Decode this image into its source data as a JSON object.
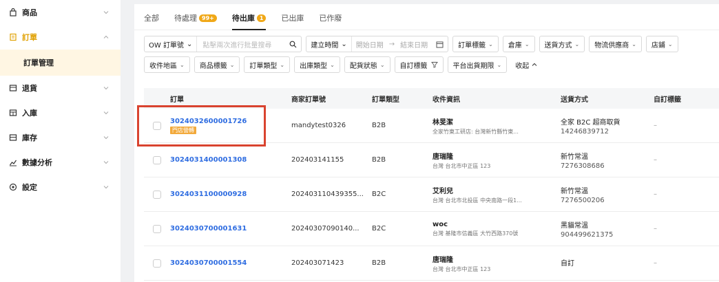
{
  "sidebar": {
    "items": [
      {
        "label": "商品",
        "icon": "bag-icon"
      },
      {
        "label": "訂單",
        "icon": "order-icon",
        "open": true
      },
      {
        "label": "退貨",
        "icon": "return-icon"
      },
      {
        "label": "入庫",
        "icon": "inbound-icon"
      },
      {
        "label": "庫存",
        "icon": "inventory-icon"
      },
      {
        "label": "數據分析",
        "icon": "chart-icon"
      },
      {
        "label": "設定",
        "icon": "settings-icon"
      }
    ],
    "sub": {
      "label": "訂單管理"
    }
  },
  "tabs": [
    {
      "label": "全部"
    },
    {
      "label": "待處理",
      "badge": "99+"
    },
    {
      "label": "待出庫",
      "badge": "1",
      "active": true
    },
    {
      "label": "已出庫"
    },
    {
      "label": "已作廢"
    }
  ],
  "filters": {
    "search_type": "OW 訂單號",
    "search_placeholder": "點擊兩次進行批量搜尋",
    "date_type": "建立時間",
    "start_date": "開始日期",
    "arrow": "→",
    "end_date": "結束日期",
    "order_tag": "訂單標籤",
    "warehouse": "倉庫",
    "shipping_method": "送貨方式",
    "logistics_provider": "物流供應商",
    "store": "店鋪",
    "recipient_region": "收件地區",
    "product_tag": "商品標籤",
    "order_type": "訂單類型",
    "outbound_type": "出庫類型",
    "allocation_status": "配貨狀態",
    "custom_tag": "自訂標籤",
    "platform_deadline": "平台出貨期限",
    "collapse": "收起"
  },
  "table": {
    "headers": [
      "訂單",
      "商家訂單號",
      "訂單類型",
      "收件資訊",
      "送貨方式",
      "自訂標籤"
    ],
    "rows": [
      {
        "order_id": "3024032600001726",
        "tag": "門店營轉",
        "merchant_no": "mandytest0326",
        "type": "B2B",
        "name": "林旻潔",
        "address": "全家竹東工研店: 台灣新竹縣竹東...",
        "ship": "全家 B2C 超商取貨",
        "tracking": "14246839712",
        "custom": "–"
      },
      {
        "order_id": "3024031400001308",
        "tag": "",
        "merchant_no": "202403141155",
        "type": "B2B",
        "name": "唐瑞隆",
        "address": "台灣 台北市中正區 123",
        "ship": "新竹常溫",
        "tracking": "7276308686",
        "custom": "–"
      },
      {
        "order_id": "3024031100000928",
        "tag": "",
        "merchant_no": "202403110439355...",
        "type": "B2C",
        "name": "艾利兒",
        "address": "台灣 台北市北投區 中央南路一段1...",
        "ship": "新竹常溫",
        "tracking": "7276500206",
        "custom": "–"
      },
      {
        "order_id": "3024030700001631",
        "tag": "",
        "merchant_no": "20240307090140...",
        "type": "B2C",
        "name": "woc",
        "address": "台灣 基隆市信義區 大竹西路370號",
        "ship": "黑貓常溫",
        "tracking": "904499621375",
        "custom": "–"
      },
      {
        "order_id": "3024030700001554",
        "tag": "",
        "merchant_no": "202403071423",
        "type": "B2B",
        "name": "唐瑞隆",
        "address": "台灣 台北市中正區 123",
        "ship": "自訂",
        "tracking": "",
        "custom": "–"
      }
    ]
  },
  "colors": {
    "accent": "#f0a818",
    "link": "#2f6de1",
    "highlight": "#d9432f"
  }
}
